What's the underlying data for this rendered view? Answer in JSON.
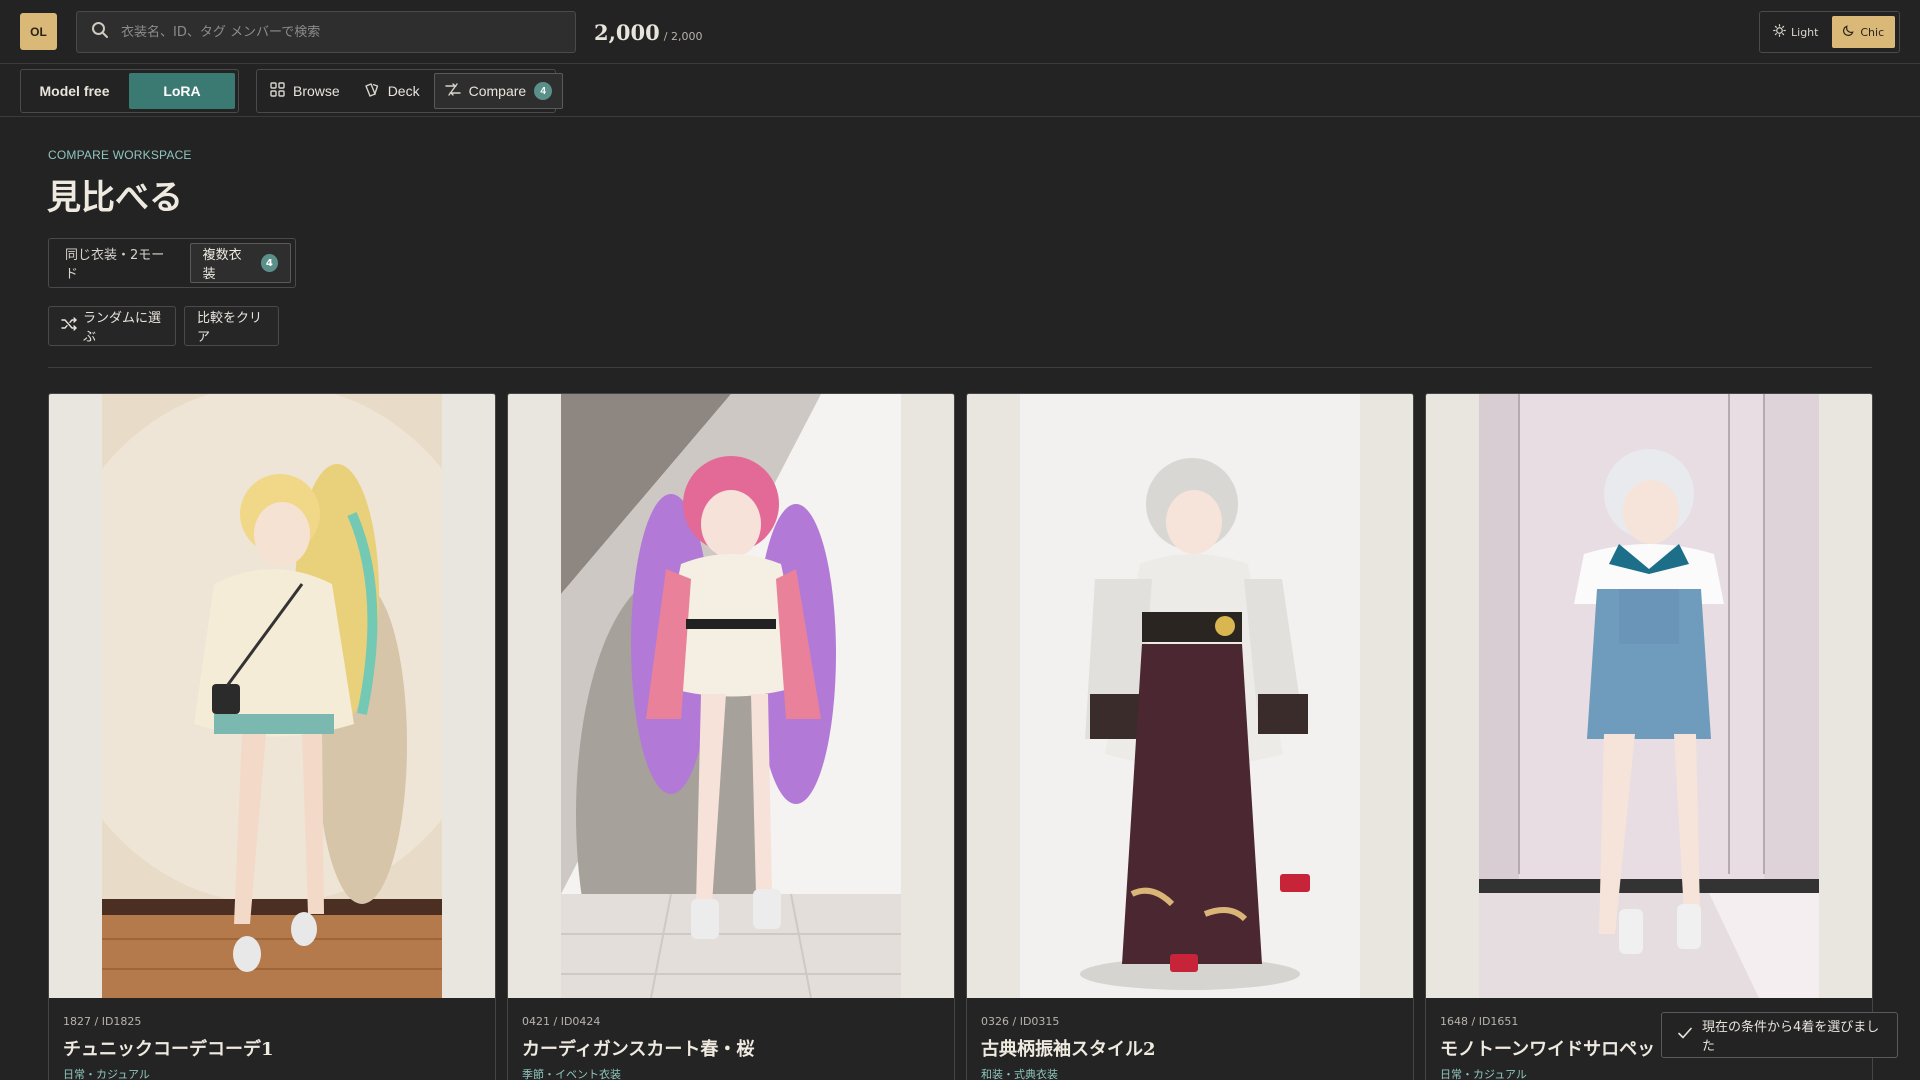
{
  "app": {
    "logo_text": "OL"
  },
  "search": {
    "placeholder": "衣装名、ID、タグ メンバーで検索",
    "value": ""
  },
  "counter": {
    "shown": "2,000",
    "total": "/ 2,000"
  },
  "theme": {
    "options": [
      {
        "label": "Light",
        "icon": "sun-icon",
        "active": false
      },
      {
        "label": "Chic",
        "icon": "moon-icon",
        "active": true
      }
    ],
    "accent": "#d9b878"
  },
  "nav": {
    "model_modes": [
      {
        "label": "Model free",
        "active": false
      },
      {
        "label": "LoRA",
        "active": true
      }
    ],
    "views": [
      {
        "label": "Browse",
        "icon": "grid-icon",
        "active": false
      },
      {
        "label": "Deck",
        "icon": "cards-icon",
        "active": false
      },
      {
        "label": "Compare",
        "icon": "compare-icon",
        "active": true,
        "badge": "4"
      }
    ]
  },
  "compare": {
    "eyebrow": "COMPARE WORKSPACE",
    "title": "見比べる",
    "modes": [
      {
        "label": "同じ衣装・2モード",
        "active": false
      },
      {
        "label": "複数衣装",
        "active": true,
        "badge": "4"
      }
    ],
    "random_label": "ランダムに選ぶ",
    "clear_label": "比較をクリア"
  },
  "cards": [
    {
      "meta": "1827 / ID1825",
      "name": "チュニックコーデコーデ1",
      "category": "日常・カジュアル"
    },
    {
      "meta": "0421 / ID0424",
      "name": "カーディガンスカート春・桜",
      "category": "季節・イベント衣装"
    },
    {
      "meta": "0326 / ID0315",
      "name": "古典柄振袖スタイル2",
      "category": "和装・式典衣装"
    },
    {
      "meta": "1648 / ID1651",
      "name": "モノトーンワイドサロペッ",
      "category": "日常・カジュアル"
    }
  ],
  "toast": {
    "text": "現在の条件から4着を選びました",
    "icon": "check-icon"
  },
  "colors": {
    "background": "#232323",
    "teal": "#3b7a73",
    "teal_text": "#8fc6be",
    "gold": "#d9b878"
  }
}
